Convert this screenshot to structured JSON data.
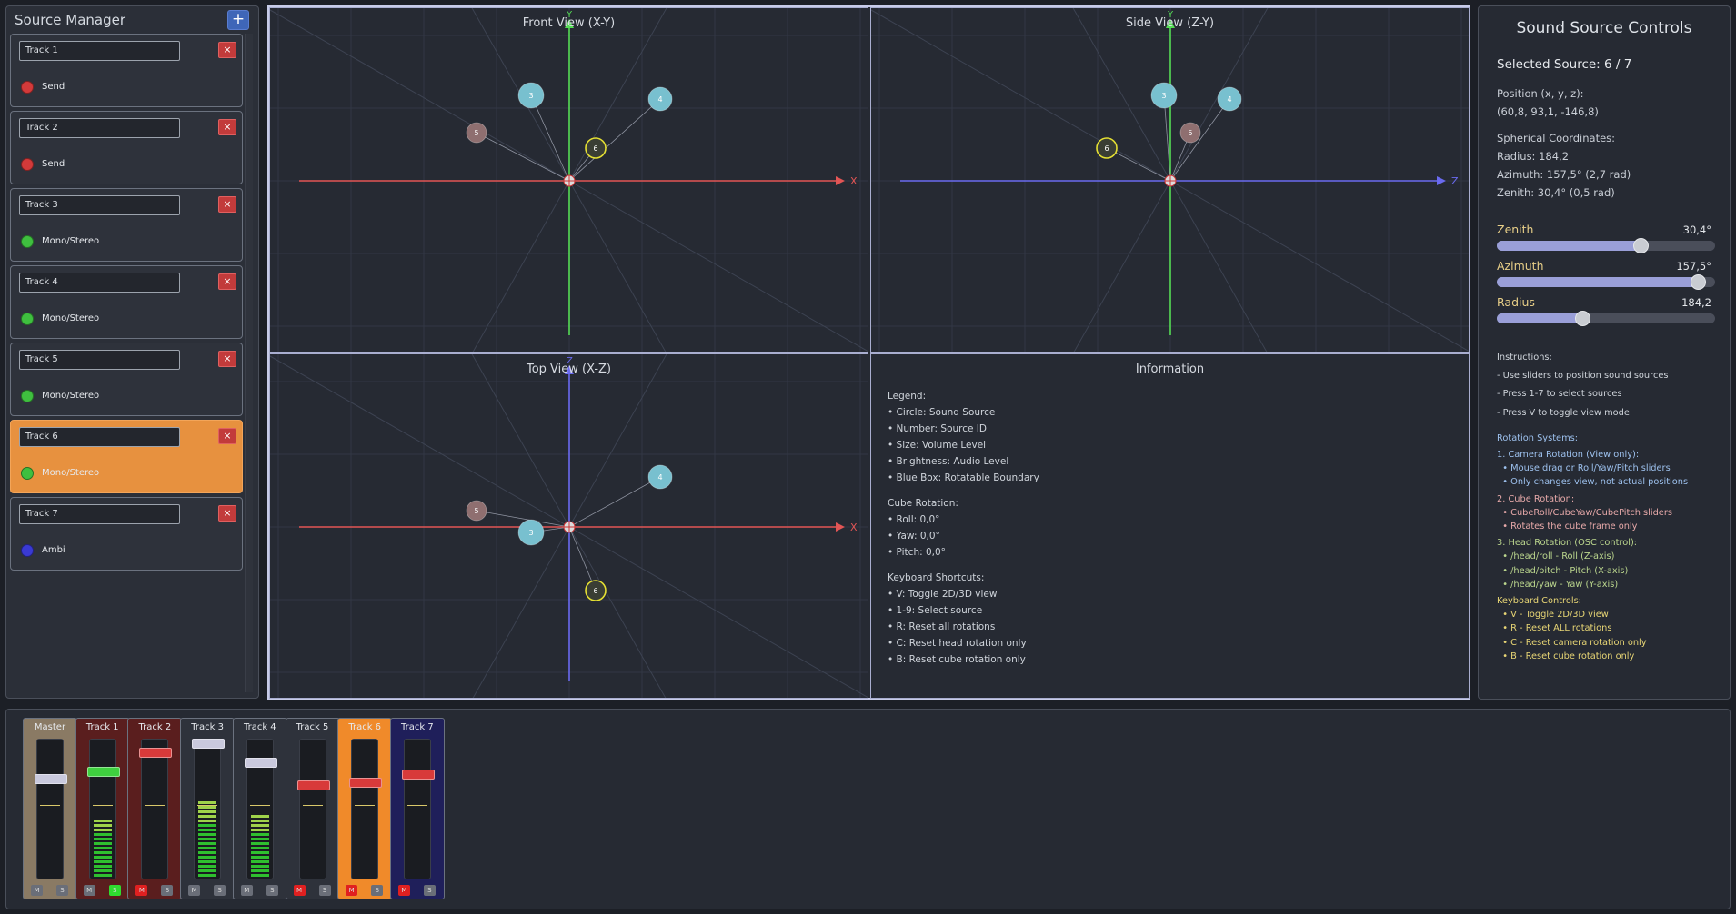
{
  "source_manager": {
    "title": "Source Manager",
    "add_label": "+",
    "tracks": [
      {
        "name": "Track 1",
        "type": "Send",
        "color": "#d33a3a"
      },
      {
        "name": "Track 2",
        "type": "Send",
        "color": "#d33a3a"
      },
      {
        "name": "Track 3",
        "type": "Mono/Stereo",
        "color": "#3fbf3f"
      },
      {
        "name": "Track 4",
        "type": "Mono/Stereo",
        "color": "#3fbf3f"
      },
      {
        "name": "Track 5",
        "type": "Mono/Stereo",
        "color": "#3fbf3f"
      },
      {
        "name": "Track 6",
        "type": "Mono/Stereo",
        "color": "#3fbf3f"
      },
      {
        "name": "Track 7",
        "type": "Ambi",
        "color": "#3a3ad3"
      }
    ],
    "delete_label": "×",
    "selected_index": 5
  },
  "views": {
    "front": {
      "title": "Front View (X-Y)",
      "h_axis": "X",
      "v_axis": "Y"
    },
    "side": {
      "title": "Side View (Z-Y)",
      "h_axis": "Z",
      "v_axis": "Y"
    },
    "top": {
      "title": "Top View (X-Z)",
      "h_axis": "X",
      "v_axis": "Z"
    }
  },
  "sources": [
    {
      "id": "3",
      "color": "#78c0cf",
      "front": [
        -42,
        -94
      ],
      "side": [
        -7,
        -94
      ],
      "top": [
        -42,
        6
      ]
    },
    {
      "id": "4",
      "color": "#78c0cf",
      "front": [
        100,
        -90
      ],
      "side": [
        65,
        -90
      ],
      "top": [
        100,
        -55
      ]
    },
    {
      "id": "5",
      "color": "#8f6f70",
      "front": [
        -102,
        -53
      ],
      "side": [
        22,
        -53
      ],
      "top": [
        -102,
        -18
      ]
    },
    {
      "id": "6",
      "color": "#3a3e34",
      "front": [
        29,
        -36
      ],
      "side": [
        -70,
        -36
      ],
      "top": [
        29,
        70
      ]
    }
  ],
  "info": {
    "title": "Information",
    "lines": [
      {
        "text": "Legend:",
        "head": true
      },
      {
        "text": "• Circle: Sound Source"
      },
      {
        "text": "• Number: Source ID"
      },
      {
        "text": "• Size: Volume Level"
      },
      {
        "text": "• Brightness: Audio Level"
      },
      {
        "text": "• Blue Box: Rotatable Boundary"
      },
      {
        "text": "Cube Rotation:",
        "head": true
      },
      {
        "text": "• Roll: 0,0°"
      },
      {
        "text": "• Yaw: 0,0°"
      },
      {
        "text": "• Pitch: 0,0°"
      },
      {
        "text": "Keyboard Shortcuts:",
        "head": true
      },
      {
        "text": "• V: Toggle 2D/3D view"
      },
      {
        "text": "• 1-9: Select source"
      },
      {
        "text": "• R: Reset all rotations"
      },
      {
        "text": "• C: Reset head rotation only"
      },
      {
        "text": "• B: Reset cube rotation only"
      }
    ]
  },
  "controls": {
    "title": "Sound Source Controls",
    "selected": "Selected Source: 6 / 7",
    "position_label": "Position (x, y, z):",
    "position_value": "(60,8, 93,1, -146,8)",
    "spherical_label": "Spherical Coordinates:",
    "radius_text": "Radius: 184,2",
    "azimuth_text": "Azimuth: 157,5° (2,7 rad)",
    "zenith_text": "Zenith: 30,4° (0,5 rad)",
    "sliders": [
      {
        "label": "Zenith",
        "value": "30,4°",
        "fraction": 0.66
      },
      {
        "label": "Azimuth",
        "value": "157,5°",
        "fraction": 0.92
      },
      {
        "label": "Radius",
        "value": "184,2",
        "fraction": 0.39
      }
    ],
    "instructions": [
      {
        "text": "Instructions:",
        "style": "white"
      },
      {
        "text": "- Use sliders to position sound sources",
        "style": "white"
      },
      {
        "text": "- Press 1-7 to select sources",
        "style": "white"
      },
      {
        "text": "- Press V to toggle view mode",
        "style": "white"
      },
      {
        "text": "Rotation Systems:",
        "style": "blue",
        "gap": true
      },
      {
        "text": "1. Camera Rotation (View only):",
        "style": "blue"
      },
      {
        "text": "  • Mouse drag or Roll/Yaw/Pitch sliders",
        "style": "blue"
      },
      {
        "text": "  • Only changes view, not actual positions",
        "style": "blue"
      },
      {
        "text": "2. Cube Rotation:",
        "style": "pink"
      },
      {
        "text": "  • CubeRoll/CubeYaw/CubePitch sliders",
        "style": "pink"
      },
      {
        "text": "  • Rotates the cube frame only",
        "style": "pink"
      },
      {
        "text": "3. Head Rotation (OSC control):",
        "style": "green"
      },
      {
        "text": "  • /head/roll - Roll (Z-axis)",
        "style": "green"
      },
      {
        "text": "  • /head/pitch - Pitch (X-axis)",
        "style": "green"
      },
      {
        "text": "  • /head/yaw - Yaw (Y-axis)",
        "style": "green"
      },
      {
        "text": "Keyboard Controls:",
        "style": "yellow"
      },
      {
        "text": "  • V - Toggle 2D/3D view",
        "style": "yellow"
      },
      {
        "text": "  • R - Reset ALL rotations",
        "style": "yellow"
      },
      {
        "text": "  • C - Reset camera rotation only",
        "style": "yellow"
      },
      {
        "text": "  • B - Reset cube rotation only",
        "style": "yellow"
      }
    ]
  },
  "mixer": {
    "mute_label": "M",
    "solo_label": "S",
    "strips": [
      {
        "name": "Master",
        "bg": "#8a7a64",
        "cap": "#c9c9dd",
        "fader": 0.28,
        "meter": 0,
        "mute_on": false,
        "solo_on": false
      },
      {
        "name": "Track 1",
        "bg": "#5a1e1e",
        "cap": "#3fcf3f",
        "fader": 0.22,
        "meter": 0.42,
        "mute_on": false,
        "solo_on": true
      },
      {
        "name": "Track 2",
        "bg": "#5a1e1e",
        "cap": "#d83a3a",
        "fader": 0.07,
        "meter": 0,
        "mute_on": true,
        "solo_on": false
      },
      {
        "name": "Track 3",
        "bg": "#2e323b",
        "cap": "#c9c9dd",
        "fader": 0.0,
        "meter": 0.55,
        "mute_on": false,
        "solo_on": false
      },
      {
        "name": "Track 4",
        "bg": "#2e323b",
        "cap": "#c9c9dd",
        "fader": 0.15,
        "meter": 0.48,
        "mute_on": false,
        "solo_on": false
      },
      {
        "name": "Track 5",
        "bg": "#2e323b",
        "cap": "#d83a3a",
        "fader": 0.33,
        "meter": 0,
        "mute_on": true,
        "solo_on": false
      },
      {
        "name": "Track 6",
        "bg": "#f08a2a",
        "cap": "#d83a3a",
        "fader": 0.31,
        "meter": 0,
        "mute_on": true,
        "solo_on": false
      },
      {
        "name": "Track 7",
        "bg": "#1f1f5a",
        "cap": "#d83a3a",
        "fader": 0.24,
        "meter": 0,
        "mute_on": true,
        "solo_on": false
      }
    ]
  }
}
